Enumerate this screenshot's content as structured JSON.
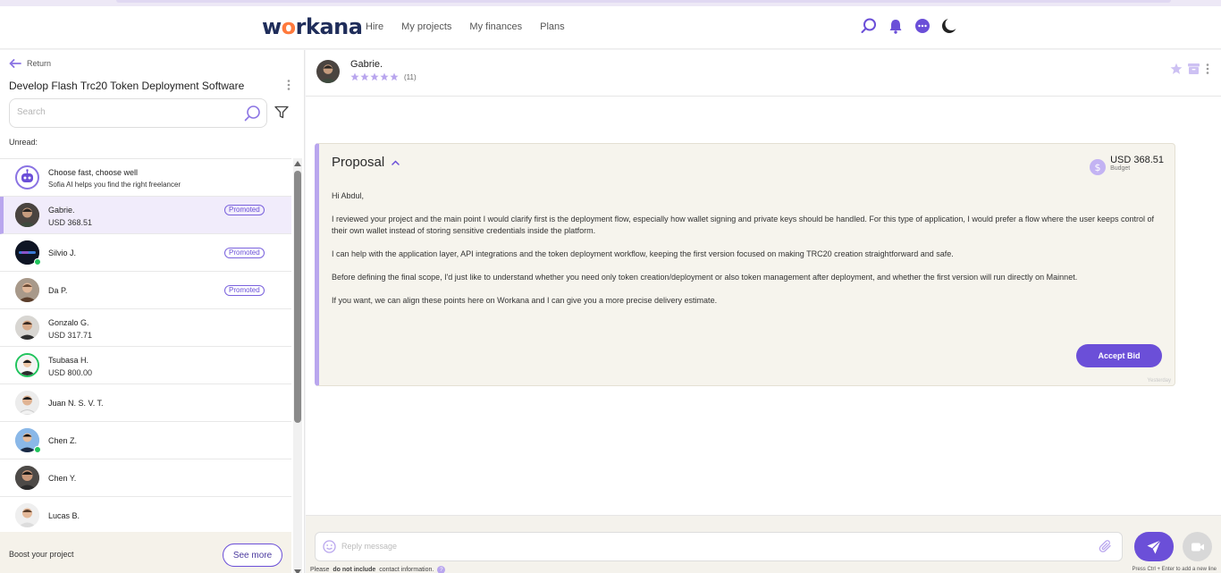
{
  "header": {
    "logo": "workana",
    "nav": [
      "Hire",
      "My projects",
      "My finances",
      "Plans"
    ]
  },
  "sidebar": {
    "return_label": "Return",
    "project_title": "Develop Flash Trc20 Token Deployment Software",
    "search_placeholder": "Search",
    "unread_label": "Unread:",
    "ai_item": {
      "title": "Choose fast, choose well",
      "subtitle": "Sofia AI helps you find the right freelancer"
    },
    "items": [
      {
        "name": "Gabrie.",
        "sub": "USD 368.51",
        "badge": "Promoted"
      },
      {
        "name": "Silvio J.",
        "sub": "",
        "badge": "Promoted"
      },
      {
        "name": "Da P.",
        "sub": "",
        "badge": "Promoted"
      },
      {
        "name": "Gonzalo G.",
        "sub": "USD 317.71"
      },
      {
        "name": "Tsubasa H.",
        "sub": "USD 800.00"
      },
      {
        "name": "Juan N. S. V. T.",
        "sub": ""
      },
      {
        "name": "Chen Z.",
        "sub": ""
      },
      {
        "name": "Chen Y.",
        "sub": ""
      },
      {
        "name": "Lucas B.",
        "sub": ""
      }
    ],
    "boost_label": "Boost your project",
    "see_more": "See more"
  },
  "chat": {
    "freelancer_name": "Gabrie.",
    "rating_count": "(11)",
    "rating": 5,
    "proposal": {
      "title": "Proposal",
      "budget_amount": "USD 368.51",
      "budget_label": "Budget",
      "paragraphs": [
        "Hi Abdul,",
        "I reviewed your project and the main point I would clarify first is the deployment flow, especially how wallet signing and private keys should be handled. For this type of application, I would prefer a flow where the user keeps control of their own wallet instead of storing sensitive credentials inside the platform.",
        "I can help with the application layer, API integrations and the token deployment workflow, keeping the first version focused on making TRC20 creation straightforward and safe.",
        "Before defining the final scope, I'd just like to understand whether you need only token creation/deployment or also token management after deployment, and whether the first version will run directly on Mainnet.",
        "If you want, we can align these points here on Workana and I can give you a more precise delivery estimate."
      ],
      "accept_label": "Accept Bid",
      "timestamp": "Yesterday"
    },
    "composer": {
      "placeholder": "Reply message",
      "note_prefix": "Please",
      "note_bold": "do not include",
      "note_suffix": "contact information.",
      "shortcut_hint": "Press Ctrl + Enter to add a new line"
    }
  },
  "colors": {
    "accent": "#6b4fd8",
    "accent_light": "#b9a6ee",
    "online": "#21c45d",
    "brand": "#1f2d5a"
  }
}
